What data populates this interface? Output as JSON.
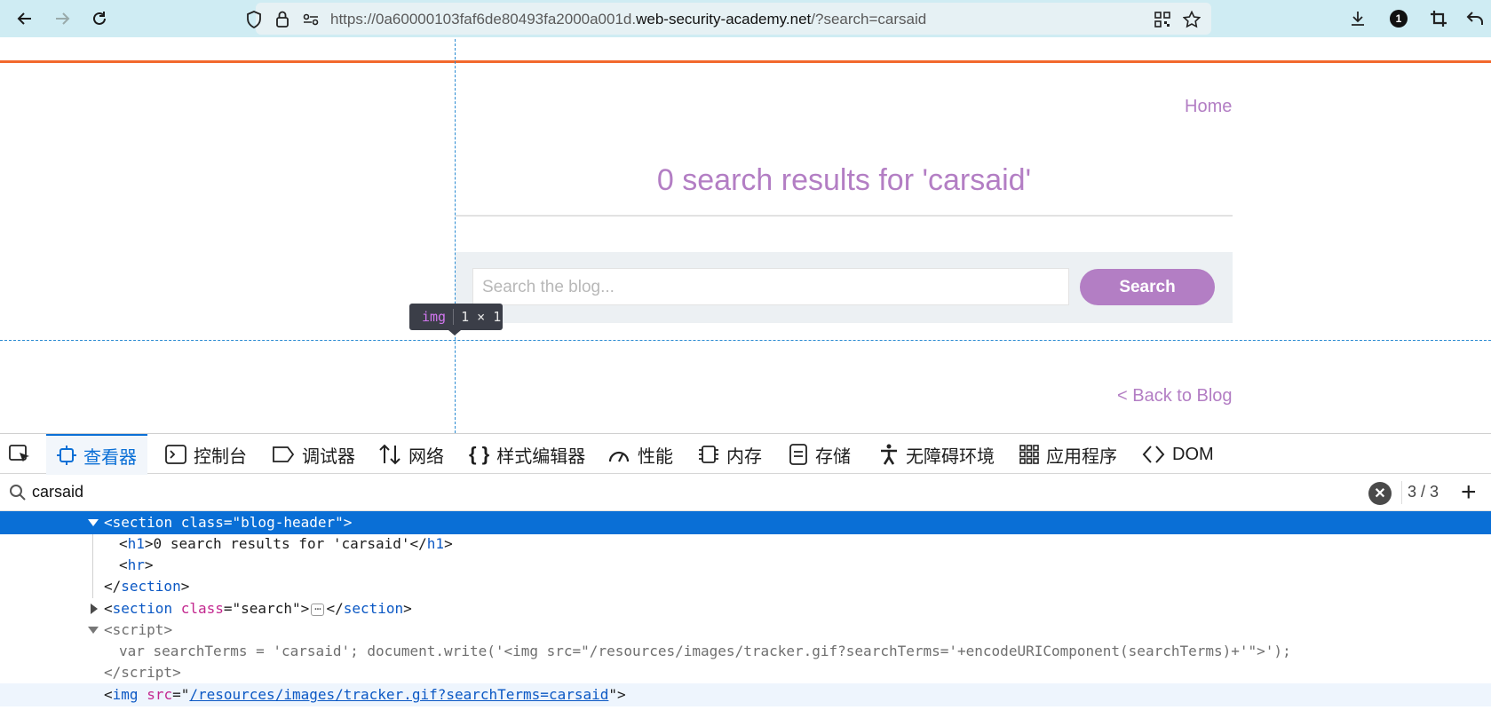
{
  "browser": {
    "url_prefix": "https://0a60000103faf6de80493fa2000a001d.",
    "url_domain": "web-security-academy.net",
    "url_suffix": "/?search=carsaid",
    "extension_badge": "1"
  },
  "page": {
    "home_link": "Home",
    "heading": "0 search results for 'carsaid'",
    "search_placeholder": "Search the blog...",
    "search_button": "Search",
    "back_link": "< Back to Blog"
  },
  "inspector_tooltip": {
    "tag": "img",
    "dims": "1 × 1"
  },
  "devtools": {
    "tabs": [
      {
        "label": "查看器",
        "icon": "inspector-icon"
      },
      {
        "label": "控制台",
        "icon": "console-icon"
      },
      {
        "label": "调试器",
        "icon": "debugger-icon"
      },
      {
        "label": "网络",
        "icon": "network-icon"
      },
      {
        "label": "样式编辑器",
        "icon": "style-editor-icon"
      },
      {
        "label": "性能",
        "icon": "performance-icon"
      },
      {
        "label": "内存",
        "icon": "memory-icon"
      },
      {
        "label": "存储",
        "icon": "storage-icon"
      },
      {
        "label": "无障碍环境",
        "icon": "accessibility-icon"
      },
      {
        "label": "应用程序",
        "icon": "application-icon"
      },
      {
        "label": "DOM",
        "icon": "dom-icon"
      }
    ],
    "search_query": "carsaid",
    "match_count": "3 / 3",
    "tree": {
      "l1_open": "<",
      "l1_tag": "section",
      "l1_attr": "class",
      "l1_val": "\"blog-header\"",
      "l2_h1_text": "0 search results for 'carsaid'",
      "l3_tag": "hr",
      "l4_close": "section",
      "l5_tag": "section",
      "l5_attr": "class",
      "l5_val": "\"search\"",
      "l5_ellipsis": "⋯",
      "l6_tag": "script",
      "l7_code": "var searchTerms = 'carsaid'; document.write('<img src=\"/resources/images/tracker.gif?searchTerms='+encodeURIComponent(searchTerms)+'\">');",
      "l8_tag": "script",
      "l9_tag": "img",
      "l9_attr": "src",
      "l9_val": "/resources/images/tracker.gif?searchTerms=carsaid"
    }
  }
}
